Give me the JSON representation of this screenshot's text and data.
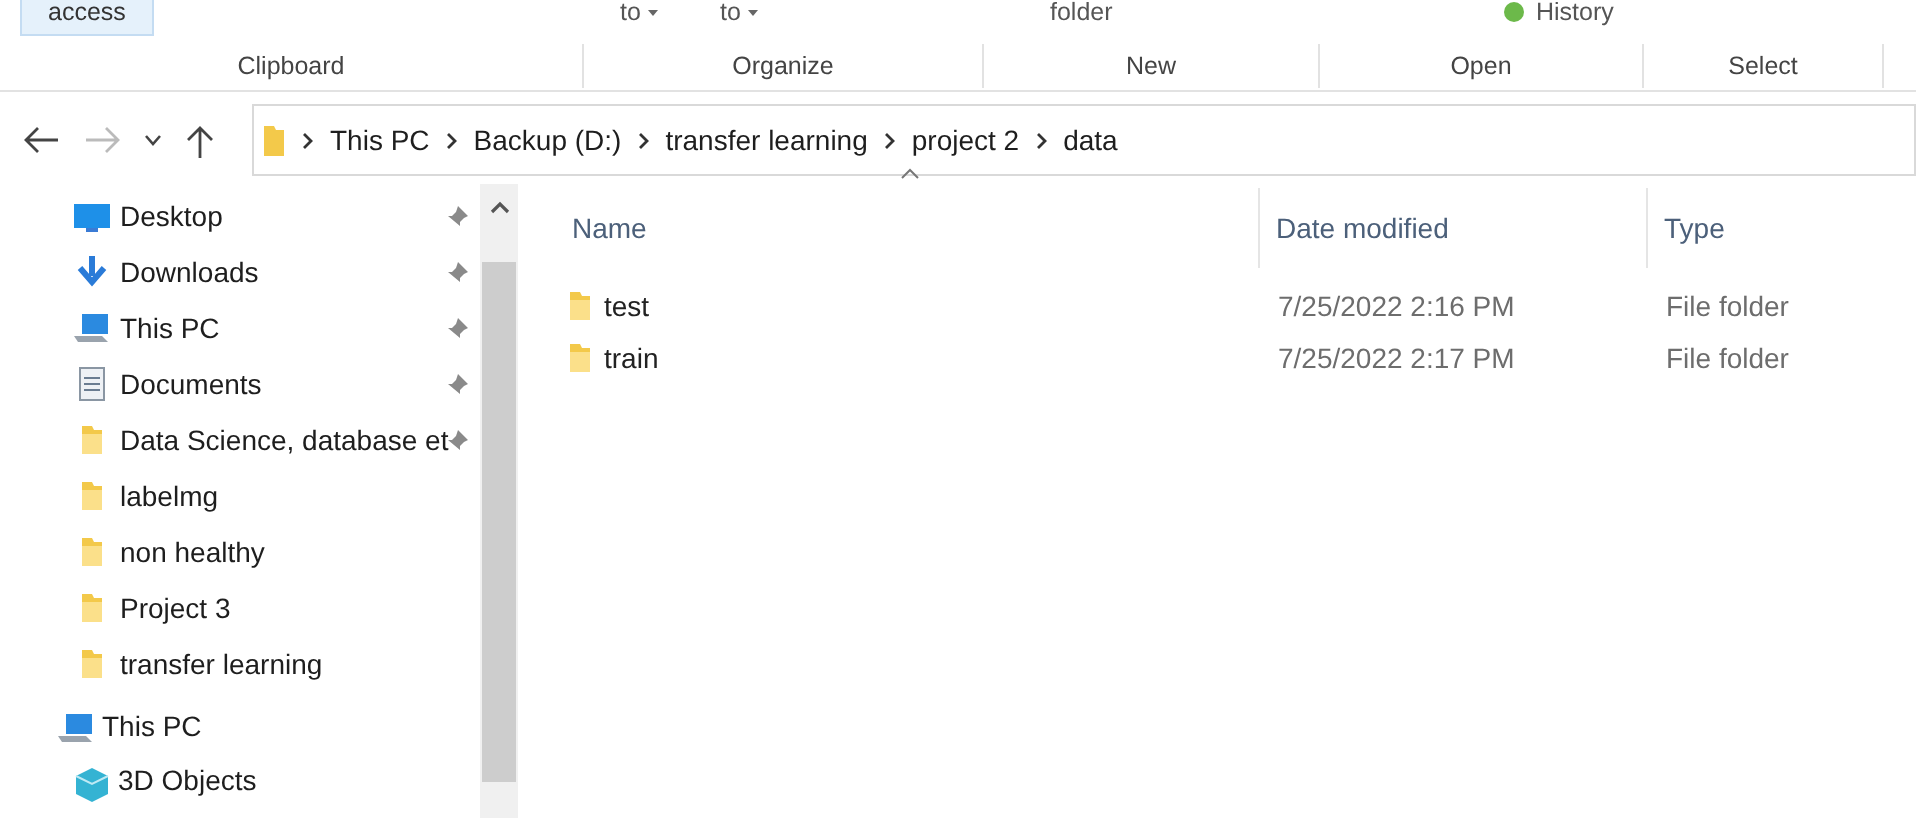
{
  "ribbon": {
    "cut_texts": [
      {
        "text": "access",
        "kind": "button"
      },
      {
        "text": "to",
        "kind": "dropdown"
      },
      {
        "text": "to",
        "kind": "dropdown"
      },
      {
        "text": "folder",
        "kind": "plain"
      },
      {
        "text": "History",
        "kind": "icon"
      }
    ],
    "groups": [
      "Clipboard",
      "Organize",
      "New",
      "Open",
      "Select"
    ]
  },
  "breadcrumb": [
    "This PC",
    "Backup (D:)",
    "transfer learning",
    "project 2",
    "data"
  ],
  "sidebar": {
    "items": [
      {
        "label": "Desktop",
        "kind": "desktop",
        "pinned": true
      },
      {
        "label": "Downloads",
        "kind": "download",
        "pinned": true
      },
      {
        "label": "This PC",
        "kind": "pc",
        "pinned": true
      },
      {
        "label": "Documents",
        "kind": "document",
        "pinned": true
      },
      {
        "label": "Data Science, database et",
        "kind": "folder",
        "pinned": true
      },
      {
        "label": "labelmg",
        "kind": "folder",
        "pinned": false
      },
      {
        "label": "non healthy",
        "kind": "folder",
        "pinned": false
      },
      {
        "label": "Project 3",
        "kind": "folder",
        "pinned": false
      },
      {
        "label": "transfer learning",
        "kind": "folder",
        "pinned": false
      }
    ],
    "sections": [
      {
        "label": "This PC",
        "kind": "pc"
      },
      {
        "label": "3D Objects",
        "kind": "cube"
      }
    ]
  },
  "table": {
    "columns": [
      "Name",
      "Date modified",
      "Type"
    ],
    "rows": [
      {
        "name": "test",
        "date": "7/25/2022 2:16 PM",
        "type": "File folder"
      },
      {
        "name": "train",
        "date": "7/25/2022 2:17 PM",
        "type": "File folder"
      }
    ]
  }
}
